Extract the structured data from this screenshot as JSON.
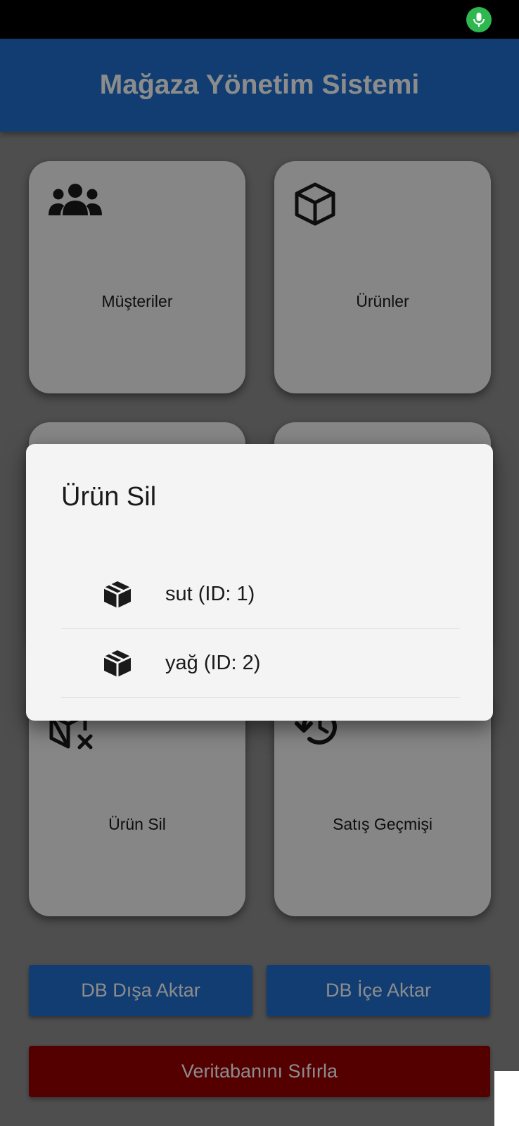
{
  "app": {
    "title": "Mağaza Yönetim Sistemi"
  },
  "status_bar": {
    "icon": "microphone-icon"
  },
  "menu": {
    "cards": [
      {
        "label": "Müşteriler",
        "icon": "group-icon"
      },
      {
        "label": "Ürünler",
        "icon": "box-icon"
      },
      {
        "label": "Ürün Sil",
        "icon": "box-remove-icon"
      },
      {
        "label": "Satış Geçmişi",
        "icon": "history-icon"
      }
    ]
  },
  "actions": {
    "export_label": "DB Dışa Aktar",
    "import_label": "DB İçe Aktar",
    "reset_label": "Veritabanını Sıfırla"
  },
  "dialog": {
    "title": "Ürün Sil",
    "items": [
      {
        "label": "sut (ID: 1)",
        "icon": "box-icon"
      },
      {
        "label": "yağ (ID: 2)",
        "icon": "box-icon"
      }
    ]
  },
  "colors": {
    "primary": "#1f6fd0",
    "danger": "#9a0000",
    "surface": "#f4f4f4",
    "mic_indicator": "#2fb84f"
  }
}
